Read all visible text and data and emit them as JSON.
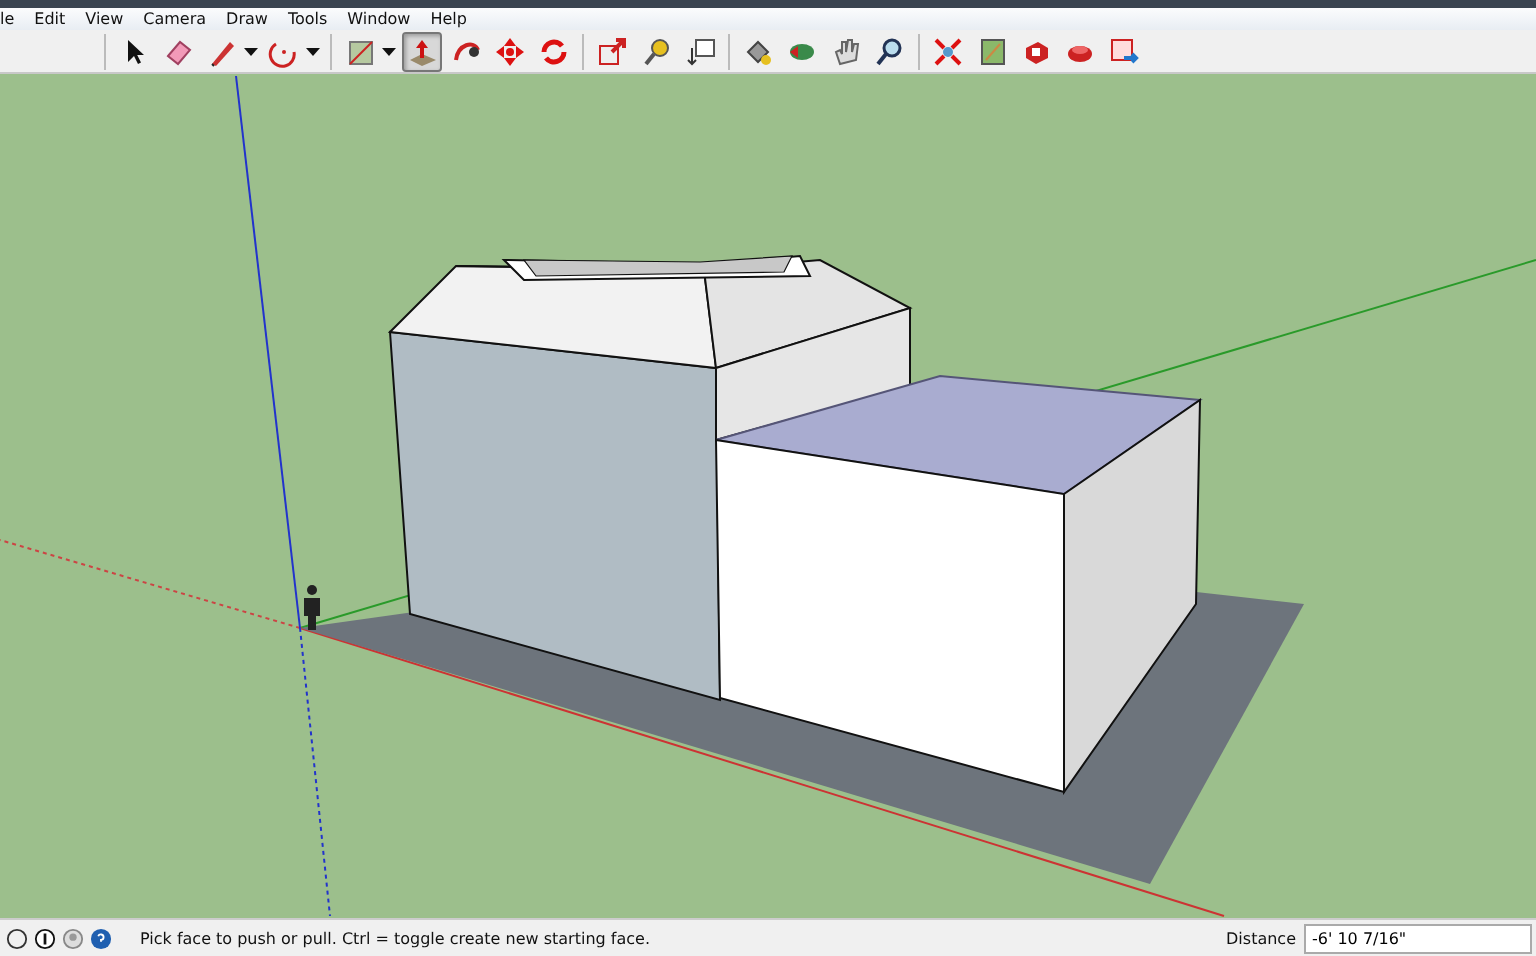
{
  "menu_bar": {
    "items": [
      "le",
      "Edit",
      "View",
      "Camera",
      "Draw",
      "Tools",
      "Window",
      "Help"
    ]
  },
  "toolbar": {
    "tools": [
      {
        "selected": false
      },
      {
        "selected": false
      },
      {
        "selected": false
      },
      {
        "selected": false
      },
      {
        "selected": false
      },
      {
        "selected": true
      },
      {
        "selected": false
      },
      {
        "selected": false
      },
      {
        "selected": false
      },
      {
        "selected": false
      },
      {
        "selected": false
      },
      {
        "selected": false
      },
      {
        "selected": false
      },
      {
        "selected": false
      },
      {
        "selected": false
      },
      {
        "selected": false
      },
      {
        "selected": false
      },
      {
        "selected": false
      },
      {
        "selected": false
      },
      {
        "selected": false
      },
      {
        "selected": false
      }
    ]
  },
  "status_bar": {
    "hint": "Pick face to push or pull.  Ctrl = toggle create new starting face.",
    "measurement_label": "Distance",
    "measurement_value": "-6' 10 7/16\""
  }
}
